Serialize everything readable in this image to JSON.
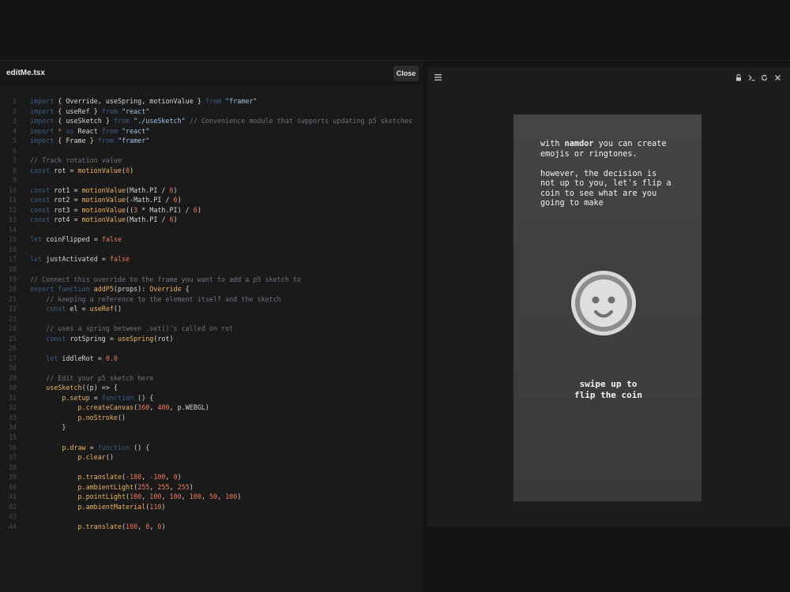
{
  "editor": {
    "file_name": "editMe.tsx",
    "close_label": "Close",
    "lines": [
      {
        "n": "1",
        "tokens": [
          {
            "t": "import",
            "c": "kw"
          },
          {
            "t": " { Override, useSpring, motionValue } ",
            "c": "plain"
          },
          {
            "t": "from",
            "c": "kw"
          },
          {
            "t": " \"framer\"",
            "c": "str"
          }
        ]
      },
      {
        "n": "2",
        "tokens": [
          {
            "t": "import",
            "c": "kw"
          },
          {
            "t": " { useRef } ",
            "c": "plain"
          },
          {
            "t": "from",
            "c": "kw"
          },
          {
            "t": " \"react\"",
            "c": "str"
          }
        ]
      },
      {
        "n": "3",
        "tokens": [
          {
            "t": "import",
            "c": "kw"
          },
          {
            "t": " { useSketch } ",
            "c": "plain"
          },
          {
            "t": "from",
            "c": "kw"
          },
          {
            "t": " \"./useSketch\"",
            "c": "str"
          },
          {
            "t": " // Convenience module that supports updating p5 sketches",
            "c": "comment"
          }
        ]
      },
      {
        "n": "4",
        "tokens": [
          {
            "t": "import",
            "c": "kw"
          },
          {
            "t": " *",
            "c": "op"
          },
          {
            "t": " as",
            "c": "kw"
          },
          {
            "t": " React ",
            "c": "plain"
          },
          {
            "t": "from",
            "c": "kw"
          },
          {
            "t": " \"react\"",
            "c": "str"
          }
        ]
      },
      {
        "n": "5",
        "tokens": [
          {
            "t": "import",
            "c": "kw"
          },
          {
            "t": " { Frame } ",
            "c": "plain"
          },
          {
            "t": "from",
            "c": "kw"
          },
          {
            "t": " \"framer\"",
            "c": "str"
          }
        ]
      },
      {
        "n": "6",
        "tokens": []
      },
      {
        "n": "7",
        "tokens": [
          {
            "t": "// Track rotation value",
            "c": "comment"
          }
        ]
      },
      {
        "n": "8",
        "tokens": [
          {
            "t": "const",
            "c": "kw"
          },
          {
            "t": " rot = ",
            "c": "plain"
          },
          {
            "t": "motionValue",
            "c": "fn"
          },
          {
            "t": "(",
            "c": "plain"
          },
          {
            "t": "0",
            "c": "num"
          },
          {
            "t": ")",
            "c": "plain"
          }
        ]
      },
      {
        "n": "9",
        "tokens": []
      },
      {
        "n": "10",
        "tokens": [
          {
            "t": "const",
            "c": "kw"
          },
          {
            "t": " rot1 = ",
            "c": "plain"
          },
          {
            "t": "motionValue",
            "c": "fn"
          },
          {
            "t": "(Math.PI / ",
            "c": "plain"
          },
          {
            "t": "6",
            "c": "num"
          },
          {
            "t": ")",
            "c": "plain"
          }
        ]
      },
      {
        "n": "11",
        "tokens": [
          {
            "t": "const",
            "c": "kw"
          },
          {
            "t": " rot2 = ",
            "c": "plain"
          },
          {
            "t": "motionValue",
            "c": "fn"
          },
          {
            "t": "(-Math.PI / ",
            "c": "plain"
          },
          {
            "t": "6",
            "c": "num"
          },
          {
            "t": ")",
            "c": "plain"
          }
        ]
      },
      {
        "n": "12",
        "tokens": [
          {
            "t": "const",
            "c": "kw"
          },
          {
            "t": " rot3 = ",
            "c": "plain"
          },
          {
            "t": "motionValue",
            "c": "fn"
          },
          {
            "t": "((",
            "c": "plain"
          },
          {
            "t": "3",
            "c": "num"
          },
          {
            "t": " * Math.PI) / ",
            "c": "plain"
          },
          {
            "t": "6",
            "c": "num"
          },
          {
            "t": ")",
            "c": "plain"
          }
        ]
      },
      {
        "n": "13",
        "tokens": [
          {
            "t": "const",
            "c": "kw"
          },
          {
            "t": " rot4 = ",
            "c": "plain"
          },
          {
            "t": "motionValue",
            "c": "fn"
          },
          {
            "t": "(Math.PI / ",
            "c": "plain"
          },
          {
            "t": "6",
            "c": "num"
          },
          {
            "t": ")",
            "c": "plain"
          }
        ]
      },
      {
        "n": "14",
        "tokens": []
      },
      {
        "n": "15",
        "tokens": [
          {
            "t": "let",
            "c": "kw"
          },
          {
            "t": " coinFlipped = ",
            "c": "plain"
          },
          {
            "t": "false",
            "c": "bool"
          }
        ]
      },
      {
        "n": "16",
        "tokens": []
      },
      {
        "n": "17",
        "tokens": [
          {
            "t": "let",
            "c": "kw"
          },
          {
            "t": " justActivated = ",
            "c": "plain"
          },
          {
            "t": "false",
            "c": "bool"
          }
        ]
      },
      {
        "n": "18",
        "tokens": []
      },
      {
        "n": "19",
        "tokens": [
          {
            "t": "// Connect this override to the frame you want to add a p5 sketch to",
            "c": "comment"
          }
        ]
      },
      {
        "n": "20",
        "tokens": [
          {
            "t": "export function",
            "c": "kw"
          },
          {
            "t": " addP5",
            "c": "fn"
          },
          {
            "t": "(props): ",
            "c": "plain"
          },
          {
            "t": "Override",
            "c": "fn"
          },
          {
            "t": " {",
            "c": "plain"
          }
        ]
      },
      {
        "n": "21",
        "tokens": [
          {
            "t": "    // keeping a reference to the element itself and the sketch",
            "c": "comment"
          }
        ]
      },
      {
        "n": "22",
        "tokens": [
          {
            "t": "    const",
            "c": "kw"
          },
          {
            "t": " el = ",
            "c": "plain"
          },
          {
            "t": "useRef",
            "c": "fn"
          },
          {
            "t": "()",
            "c": "plain"
          }
        ]
      },
      {
        "n": "23",
        "tokens": []
      },
      {
        "n": "24",
        "tokens": [
          {
            "t": "    // uses a spring between .set()'s called on rot",
            "c": "comment"
          }
        ]
      },
      {
        "n": "25",
        "tokens": [
          {
            "t": "    const",
            "c": "kw"
          },
          {
            "t": " rotSpring = ",
            "c": "plain"
          },
          {
            "t": "useSpring",
            "c": "fn"
          },
          {
            "t": "(rot)",
            "c": "plain"
          }
        ]
      },
      {
        "n": "26",
        "tokens": []
      },
      {
        "n": "27",
        "tokens": [
          {
            "t": "    let",
            "c": "kw"
          },
          {
            "t": " iddleRot = ",
            "c": "plain"
          },
          {
            "t": "0.0",
            "c": "num"
          }
        ]
      },
      {
        "n": "28",
        "tokens": []
      },
      {
        "n": "29",
        "tokens": [
          {
            "t": "    // Edit your p5 sketch here",
            "c": "comment"
          }
        ]
      },
      {
        "n": "30",
        "tokens": [
          {
            "t": "    useSketch",
            "c": "fn"
          },
          {
            "t": "((p) => {",
            "c": "plain"
          }
        ]
      },
      {
        "n": "31",
        "tokens": [
          {
            "t": "        p.setup",
            "c": "fn"
          },
          {
            "t": " = ",
            "c": "plain"
          },
          {
            "t": "function",
            "c": "kw"
          },
          {
            "t": " () {",
            "c": "plain"
          }
        ]
      },
      {
        "n": "32",
        "tokens": [
          {
            "t": "            p.createCanvas",
            "c": "fn"
          },
          {
            "t": "(",
            "c": "plain"
          },
          {
            "t": "360",
            "c": "num"
          },
          {
            "t": ", ",
            "c": "plain"
          },
          {
            "t": "400",
            "c": "num"
          },
          {
            "t": ", p.WEBGL)",
            "c": "plain"
          }
        ]
      },
      {
        "n": "33",
        "tokens": [
          {
            "t": "            p.noStroke",
            "c": "fn"
          },
          {
            "t": "()",
            "c": "plain"
          }
        ]
      },
      {
        "n": "34",
        "tokens": [
          {
            "t": "        }",
            "c": "plain"
          }
        ]
      },
      {
        "n": "35",
        "tokens": []
      },
      {
        "n": "36",
        "tokens": [
          {
            "t": "        p.draw",
            "c": "fn"
          },
          {
            "t": " = ",
            "c": "plain"
          },
          {
            "t": "function",
            "c": "kw"
          },
          {
            "t": " () {",
            "c": "plain"
          }
        ]
      },
      {
        "n": "37",
        "tokens": [
          {
            "t": "            p.clear",
            "c": "fn"
          },
          {
            "t": "()",
            "c": "plain"
          }
        ]
      },
      {
        "n": "38",
        "tokens": []
      },
      {
        "n": "39",
        "tokens": [
          {
            "t": "            p.translate",
            "c": "fn"
          },
          {
            "t": "(",
            "c": "plain"
          },
          {
            "t": "-180",
            "c": "num"
          },
          {
            "t": ", ",
            "c": "plain"
          },
          {
            "t": "-100",
            "c": "num"
          },
          {
            "t": ", ",
            "c": "plain"
          },
          {
            "t": "0",
            "c": "num"
          },
          {
            "t": ")",
            "c": "plain"
          }
        ]
      },
      {
        "n": "40",
        "tokens": [
          {
            "t": "            p.ambientLight",
            "c": "fn"
          },
          {
            "t": "(",
            "c": "plain"
          },
          {
            "t": "255",
            "c": "num"
          },
          {
            "t": ", ",
            "c": "plain"
          },
          {
            "t": "255",
            "c": "num"
          },
          {
            "t": ", ",
            "c": "plain"
          },
          {
            "t": "255",
            "c": "num"
          },
          {
            "t": ")",
            "c": "plain"
          }
        ]
      },
      {
        "n": "41",
        "tokens": [
          {
            "t": "            p.pointLight",
            "c": "fn"
          },
          {
            "t": "(",
            "c": "plain"
          },
          {
            "t": "100",
            "c": "num"
          },
          {
            "t": ", ",
            "c": "plain"
          },
          {
            "t": "100",
            "c": "num"
          },
          {
            "t": ", ",
            "c": "plain"
          },
          {
            "t": "100",
            "c": "num"
          },
          {
            "t": ", ",
            "c": "plain"
          },
          {
            "t": "100",
            "c": "num"
          },
          {
            "t": ", ",
            "c": "plain"
          },
          {
            "t": "50",
            "c": "num"
          },
          {
            "t": ", ",
            "c": "plain"
          },
          {
            "t": "100",
            "c": "num"
          },
          {
            "t": ")",
            "c": "plain"
          }
        ]
      },
      {
        "n": "42",
        "tokens": [
          {
            "t": "            p.ambientMaterial",
            "c": "fn"
          },
          {
            "t": "(",
            "c": "plain"
          },
          {
            "t": "110",
            "c": "num"
          },
          {
            "t": ")",
            "c": "plain"
          }
        ]
      },
      {
        "n": "43",
        "tokens": []
      },
      {
        "n": "44",
        "tokens": [
          {
            "t": "            p.translate",
            "c": "fn"
          },
          {
            "t": "(",
            "c": "plain"
          },
          {
            "t": "180",
            "c": "num"
          },
          {
            "t": ", ",
            "c": "plain"
          },
          {
            "t": "0",
            "c": "num"
          },
          {
            "t": ", ",
            "c": "plain"
          },
          {
            "t": "0",
            "c": "num"
          },
          {
            "t": ")",
            "c": "plain"
          }
        ]
      }
    ]
  },
  "preview": {
    "icons": {
      "menu": "menu-icon",
      "lock": "lock-icon",
      "terminal": "terminal-icon",
      "reload": "reload-icon",
      "close": "close-icon"
    },
    "phone": {
      "intro_prefix": "with ",
      "brand": "namdor",
      "intro_suffix": " you can create",
      "intro_line2": "emojis or ringtones.",
      "para2": [
        "however, the decision is",
        "not up to you, let's flip a",
        "coin to see what are you",
        "going to make"
      ],
      "swipe": [
        "swipe up to",
        "flip the coin"
      ]
    }
  }
}
